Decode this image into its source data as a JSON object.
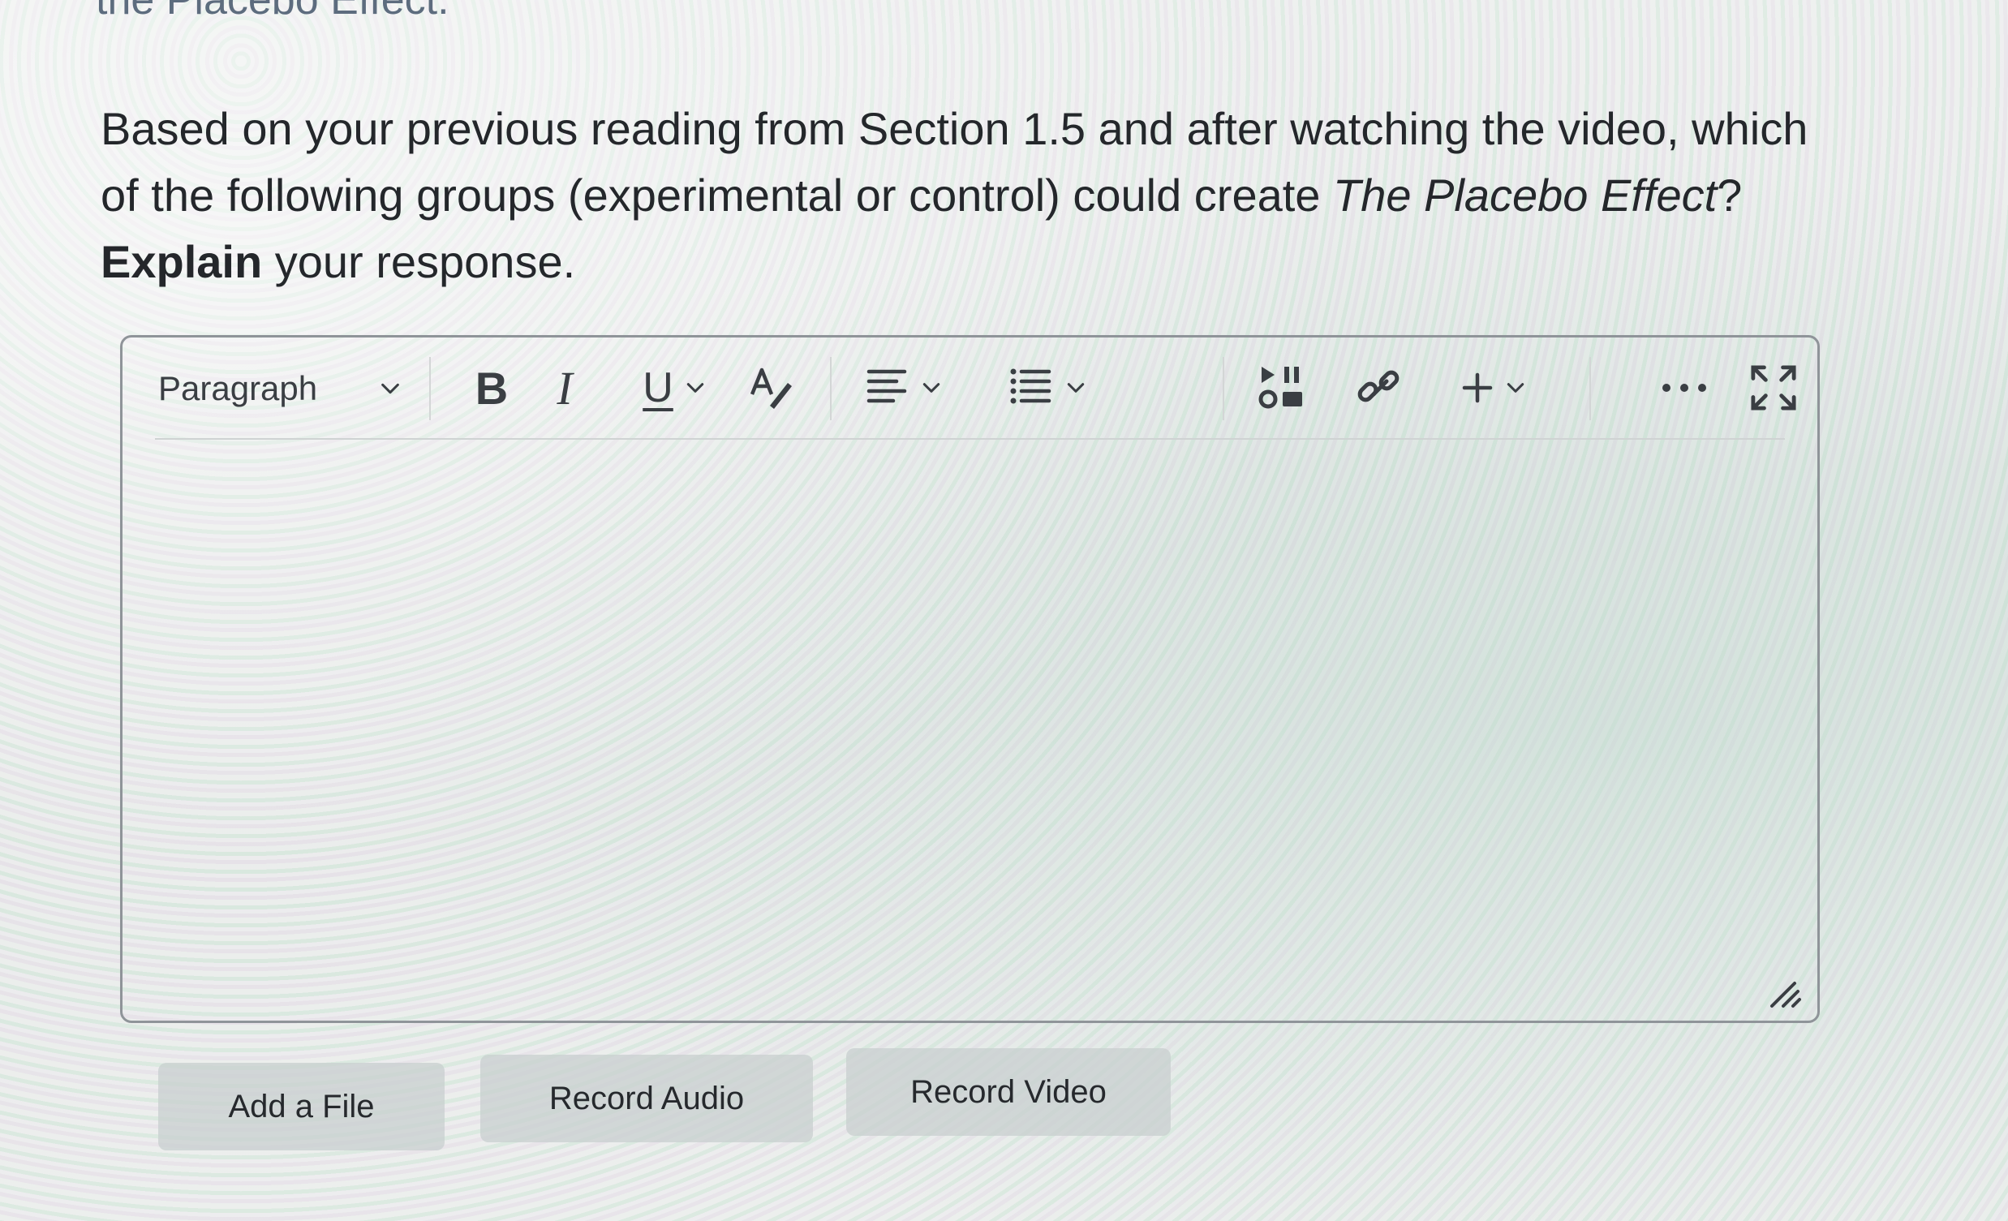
{
  "page": {
    "previous_heading_fragment": "the Placebo Effect.",
    "question": {
      "line1": "Based on your previous reading from Section 1.5 and after watching the video, which",
      "line2_start": "of the following groups (experimental or control) could create ",
      "line2_italic": "The Placebo Effect",
      "line2_end": "?",
      "line3_bold": "Explain",
      "line3_rest": " your response."
    }
  },
  "editor": {
    "format_select": {
      "value": "Paragraph"
    },
    "toolbar": {
      "bold_label": "B",
      "italic_label": "I",
      "underline_label": "U",
      "icons": [
        "bold-icon",
        "italic-icon",
        "underline-icon",
        "text-style-icon",
        "align-icon",
        "list-icon",
        "media-icon",
        "link-icon",
        "plus-icon",
        "more-icon",
        "fullscreen-icon"
      ]
    },
    "content": ""
  },
  "buttons": {
    "add_file": "Add a File",
    "record_audio": "Record Audio",
    "record_video": "Record Video"
  }
}
